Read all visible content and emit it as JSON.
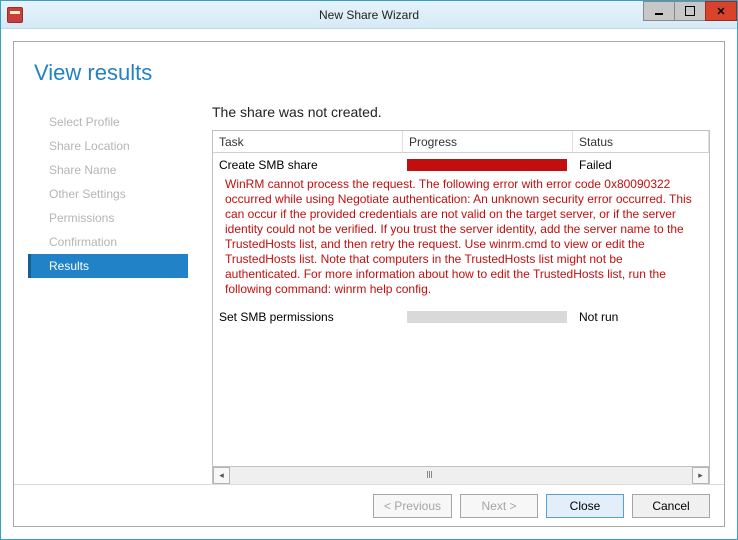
{
  "window": {
    "title": "New Share Wizard"
  },
  "heading": "View results",
  "nav": {
    "items": [
      {
        "label": "Select Profile",
        "active": false
      },
      {
        "label": "Share Location",
        "active": false
      },
      {
        "label": "Share Name",
        "active": false
      },
      {
        "label": "Other Settings",
        "active": false
      },
      {
        "label": "Permissions",
        "active": false
      },
      {
        "label": "Confirmation",
        "active": false
      },
      {
        "label": "Results",
        "active": true
      }
    ]
  },
  "main": {
    "message": "The share was not created.",
    "columns": {
      "task": "Task",
      "progress": "Progress",
      "status": "Status"
    },
    "tasks": [
      {
        "name": "Create SMB share",
        "status": "Failed",
        "progress_state": "error",
        "error": "WinRM cannot process the request. The following error with error code 0x80090322 occurred while using Negotiate authentication: An unknown security error occurred.  This can occur if the provided credentials are not valid on the target server, or if the server identity could not be verified.  If you trust the server identity, add the server name to the TrustedHosts list, and then retry the request. Use winrm.cmd to view or edit the TrustedHosts list. Note that computers in the TrustedHosts list might not be authenticated. For more information about how to edit the TrustedHosts list, run the following command: winrm help config."
      },
      {
        "name": "Set SMB permissions",
        "status": "Not run",
        "progress_state": "notrun",
        "error": null
      }
    ]
  },
  "footer": {
    "previous": "< Previous",
    "next": "Next >",
    "close": "Close",
    "cancel": "Cancel"
  }
}
